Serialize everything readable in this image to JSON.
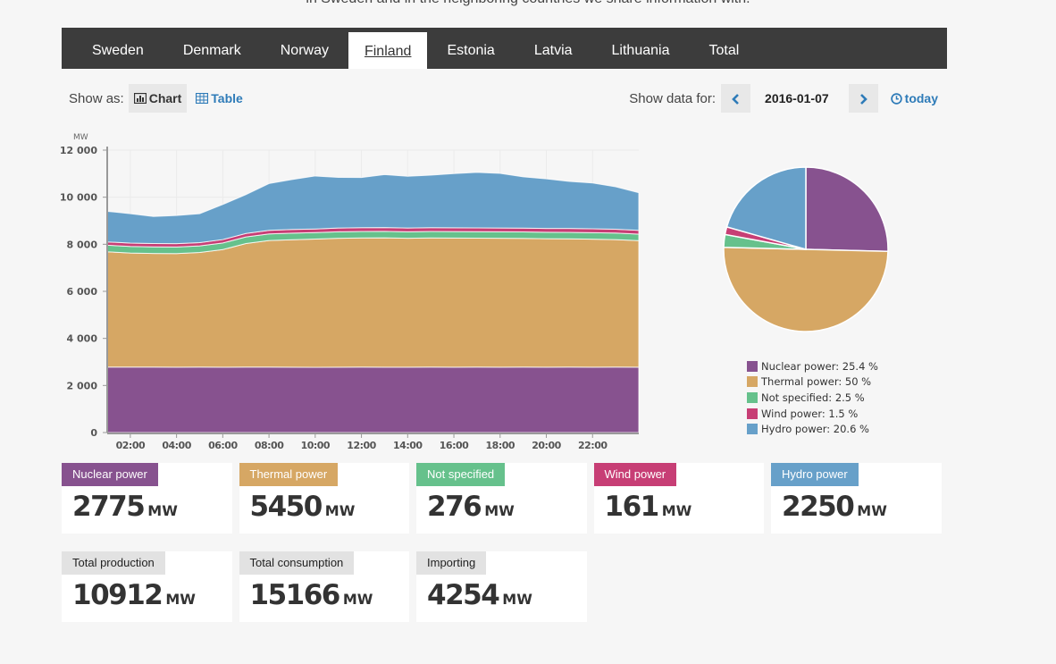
{
  "intro_text": "in Sweden and in the neighboring countries we share information with.",
  "tabs": [
    {
      "label": "Sweden",
      "active": false
    },
    {
      "label": "Denmark",
      "active": false
    },
    {
      "label": "Norway",
      "active": false
    },
    {
      "label": "Finland",
      "active": true
    },
    {
      "label": "Estonia",
      "active": false
    },
    {
      "label": "Latvia",
      "active": false
    },
    {
      "label": "Lithuania",
      "active": false
    },
    {
      "label": "Total",
      "active": false
    }
  ],
  "controls": {
    "show_as_label": "Show as:",
    "chart_label": "Chart",
    "table_label": "Table",
    "show_data_for_label": "Show data for:",
    "prev_label": "‹",
    "next_label": "›",
    "date": "2016-01-07",
    "today_label": "today",
    "icons": {
      "chart": "bar-chart-icon",
      "table": "table-icon",
      "today": "clock-icon",
      "prev": "chevron-left-icon",
      "next": "chevron-right-icon"
    }
  },
  "colors": {
    "nuclear": "#87528f",
    "thermal": "#d6a764",
    "not_specified": "#66c18c",
    "wind": "#c73e75",
    "hydro": "#67a0c9",
    "accent": "#2e7bb8",
    "tabbar": "#3c3c3c"
  },
  "chart_data": [
    {
      "type": "area",
      "stacked": true,
      "ylabel": "MW",
      "xlabel": "",
      "ylim": [
        0,
        12000
      ],
      "yticks": [
        0,
        2000,
        4000,
        6000,
        8000,
        10000,
        12000
      ],
      "ytick_labels": [
        "0",
        "2 000",
        "4 000",
        "6 000",
        "8 000",
        "10 000",
        "12 000"
      ],
      "xlim_hours": [
        1.0,
        24.0
      ],
      "xticks": [
        "02:00",
        "04:00",
        "06:00",
        "08:00",
        "10:00",
        "12:00",
        "14:00",
        "16:00",
        "18:00",
        "20:00",
        "22:00"
      ],
      "xtick_hours": [
        2,
        4,
        6,
        8,
        10,
        12,
        14,
        16,
        18,
        20,
        22
      ],
      "grid": true,
      "x_hours": [
        1,
        2,
        3,
        4,
        5,
        6,
        7,
        8,
        9,
        10,
        11,
        12,
        13,
        14,
        15,
        16,
        17,
        18,
        19,
        20,
        21,
        22,
        23,
        24
      ],
      "series": [
        {
          "name": "Nuclear power",
          "key": "nuclear",
          "values": [
            2780,
            2780,
            2780,
            2775,
            2780,
            2775,
            2780,
            2780,
            2775,
            2770,
            2775,
            2780,
            2775,
            2775,
            2780,
            2775,
            2780,
            2775,
            2780,
            2775,
            2780,
            2775,
            2780,
            2775
          ]
        },
        {
          "name": "Thermal power",
          "key": "thermal",
          "values": [
            4900,
            4850,
            4830,
            4830,
            4870,
            5000,
            5250,
            5380,
            5420,
            5450,
            5480,
            5490,
            5500,
            5480,
            5490,
            5490,
            5480,
            5480,
            5470,
            5460,
            5450,
            5440,
            5420,
            5380
          ]
        },
        {
          "name": "Not specified",
          "key": "not_specified",
          "values": [
            280,
            280,
            280,
            280,
            280,
            280,
            280,
            280,
            280,
            276,
            276,
            276,
            276,
            276,
            276,
            276,
            276,
            276,
            276,
            276,
            276,
            276,
            276,
            276
          ]
        },
        {
          "name": "Wind power",
          "key": "wind",
          "values": [
            140,
            140,
            140,
            140,
            140,
            145,
            150,
            150,
            155,
            155,
            160,
            160,
            160,
            160,
            160,
            160,
            160,
            160,
            160,
            160,
            165,
            165,
            165,
            161
          ]
        },
        {
          "name": "Hydro power",
          "key": "hydro",
          "values": [
            1300,
            1250,
            1150,
            1200,
            1230,
            1490,
            1650,
            1990,
            2120,
            2250,
            2150,
            2130,
            2250,
            2200,
            2230,
            2300,
            2360,
            2320,
            2180,
            2110,
            2000,
            1950,
            1800,
            1600
          ]
        }
      ]
    },
    {
      "type": "pie",
      "labels": [
        "Nuclear power",
        "Thermal power",
        "Not specified",
        "Wind power",
        "Hydro power"
      ],
      "keys": [
        "nuclear",
        "thermal",
        "not_specified",
        "wind",
        "hydro"
      ],
      "values": [
        25.4,
        50,
        2.5,
        1.5,
        20.6
      ],
      "legend_text": [
        "Nuclear power: 25.4 %",
        "Thermal power: 50 %",
        "Not specified: 2.5 %",
        "Wind power: 1.5 %",
        "Hydro power: 20.6 %"
      ],
      "legend": "bottom"
    }
  ],
  "production_cards": [
    {
      "label": "Nuclear power",
      "key": "nuclear",
      "value": "2775",
      "unit": "MW"
    },
    {
      "label": "Thermal power",
      "key": "thermal",
      "value": "5450",
      "unit": "MW"
    },
    {
      "label": "Not specified",
      "key": "not_specified",
      "value": "276",
      "unit": "MW"
    },
    {
      "label": "Wind power",
      "key": "wind",
      "value": "161",
      "unit": "MW"
    },
    {
      "label": "Hydro power",
      "key": "hydro",
      "value": "2250",
      "unit": "MW"
    }
  ],
  "summary_cards": [
    {
      "label": "Total production",
      "value": "10912",
      "unit": "MW"
    },
    {
      "label": "Total consumption",
      "value": "15166",
      "unit": "MW"
    },
    {
      "label": "Importing",
      "value": "4254",
      "unit": "MW"
    }
  ]
}
